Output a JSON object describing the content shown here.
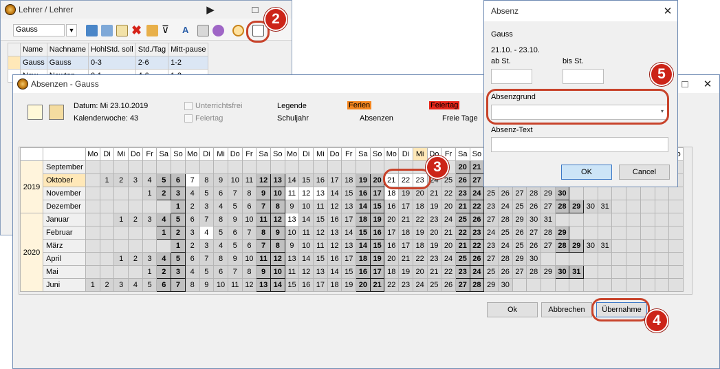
{
  "lehrer_window": {
    "title": "Lehrer / Lehrer",
    "select_value": "Gauss",
    "columns": [
      "Name",
      "Nachname",
      "HohlStd. soll",
      "Std./Tag",
      "Mitt-pause"
    ],
    "rows": [
      [
        "Gauss",
        "Gauss",
        "0-3",
        "2-6",
        "1-2"
      ],
      [
        "New...",
        "Newton",
        "0-1",
        "4-6",
        "1-2"
      ]
    ]
  },
  "absenzen_window": {
    "title": "Absenzen - Gauss",
    "datum": "Datum: Mi 23.10.2019",
    "kw": "Kalenderwoche: 43",
    "unterrichtsfrei": "Unterrichtsfrei",
    "feiertag_cb": "Feiertag",
    "legende": "Legende",
    "schuljahr": "Schuljahr",
    "ferien": "Ferien",
    "absenzen": "Absenzen",
    "feiertag": "Feiertag",
    "freie_tage": "Freie Tage",
    "ok": "Ok",
    "abbrechen": "Abbrechen",
    "uebernahme": "Übernahme",
    "day_headers": [
      "Mo",
      "Di",
      "Mi",
      "Do",
      "Fr",
      "Sa",
      "So",
      "Mo",
      "Di",
      "Mi",
      "Do",
      "Fr",
      "Sa",
      "So",
      "Mo",
      "Di",
      "Mi",
      "Do",
      "Fr",
      "Sa",
      "So",
      "Mo",
      "Di",
      "Mi",
      "Do",
      "Fr",
      "Sa",
      "So",
      "Mo",
      "Di",
      "Mi",
      "Do",
      "Fr",
      "Sa",
      "So",
      "Mo",
      "Di",
      "Mi",
      "Do",
      "Fr",
      "Sa",
      "So"
    ],
    "years": [
      "2019",
      "2020"
    ],
    "months": [
      {
        "name": "September",
        "start": 0,
        "days": 0,
        "visible": "20 21 22"
      },
      {
        "name": "Oktober",
        "start": 1,
        "days": 31
      },
      {
        "name": "November",
        "start": 4,
        "days": 30
      },
      {
        "name": "Dezember",
        "start": 6,
        "days": 31
      },
      {
        "name": "Januar",
        "start": 2,
        "days": 31
      },
      {
        "name": "Februar",
        "start": 5,
        "days": 29
      },
      {
        "name": "März",
        "start": 6,
        "days": 31
      },
      {
        "name": "April",
        "start": 2,
        "days": 30
      },
      {
        "name": "Mai",
        "start": 4,
        "days": 31
      },
      {
        "name": "Juni",
        "start": 0,
        "days": 30
      }
    ]
  },
  "absenz_dialog": {
    "title": "Absenz",
    "name": "Gauss",
    "range": "21.10. - 23.10.",
    "ab": "ab St.",
    "bis": "bis St.",
    "grund": "Absenzgrund",
    "text": "Absenz-Text",
    "ok": "OK",
    "cancel": "Cancel"
  },
  "badges": [
    "2",
    "3",
    "4",
    "5"
  ],
  "colors": {
    "ferien": "#f4861f",
    "feiertag": "#e8261a",
    "badge": "#cc2418"
  }
}
